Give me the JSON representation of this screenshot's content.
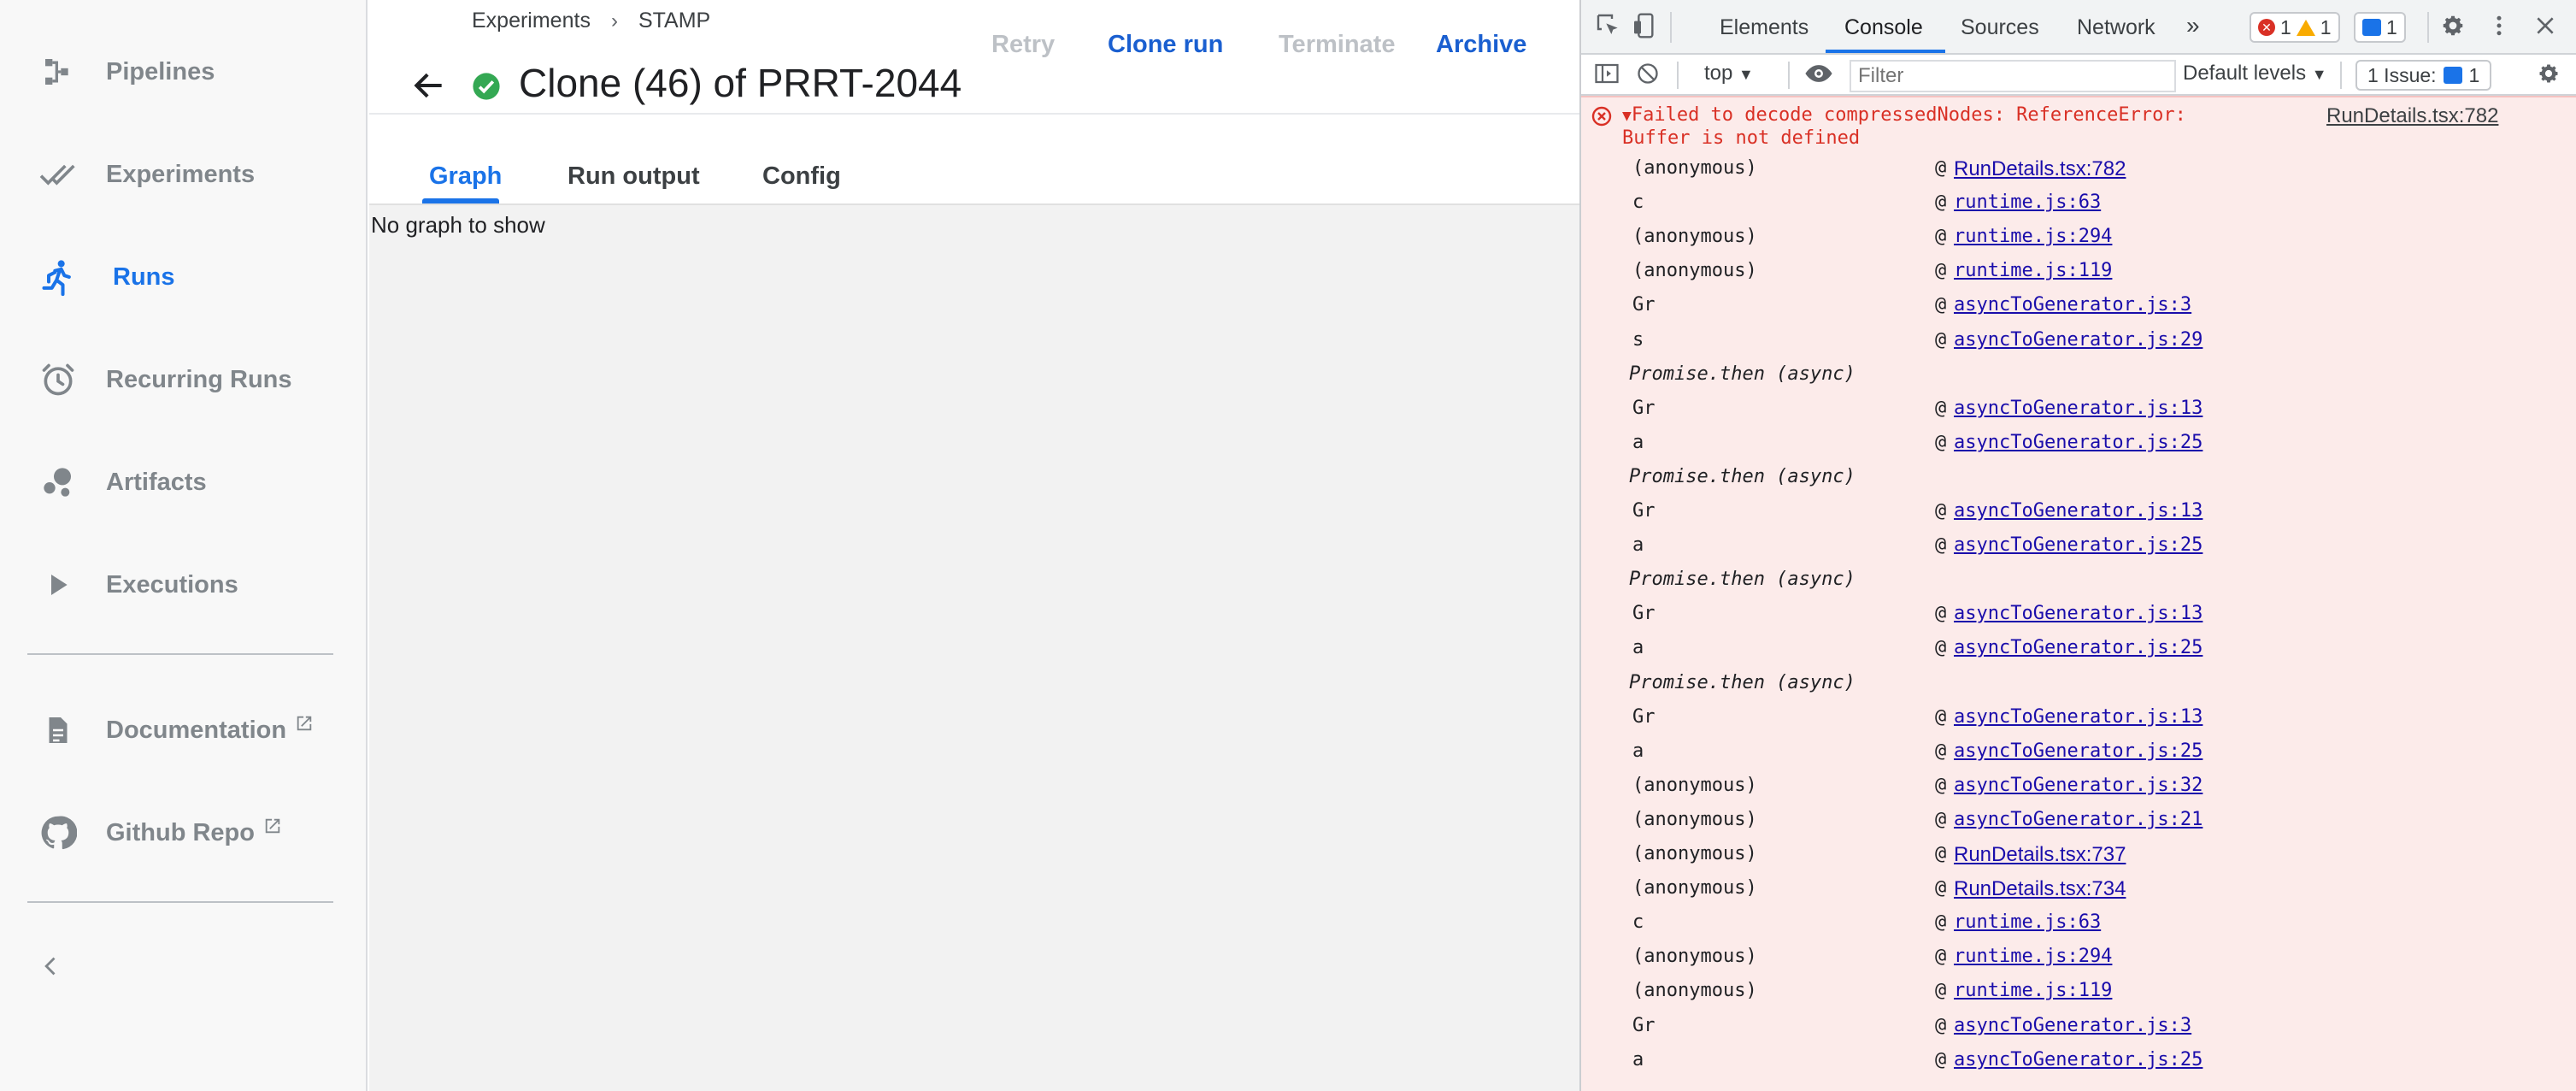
{
  "sidebar": {
    "items": [
      {
        "label": "Pipelines",
        "icon": "pipelines-icon",
        "active": false
      },
      {
        "label": "Experiments",
        "icon": "experiments-icon",
        "active": false
      },
      {
        "label": "Runs",
        "icon": "runs-icon",
        "active": true
      },
      {
        "label": "Recurring Runs",
        "icon": "alarm-clock-icon",
        "active": false
      },
      {
        "label": "Artifacts",
        "icon": "artifacts-icon",
        "active": false
      },
      {
        "label": "Executions",
        "icon": "play-icon",
        "active": false
      }
    ],
    "links": [
      {
        "label": "Documentation",
        "icon": "document-icon"
      },
      {
        "label": "Github Repo",
        "icon": "github-icon"
      }
    ],
    "collapse_icon": "chevron-left-icon"
  },
  "main": {
    "breadcrumb": [
      "Experiments",
      "STAMP"
    ],
    "breadcrumb_separator": "›",
    "title": "Clone (46) of PRRT-2044",
    "status": "succeeded",
    "actions": {
      "retry": "Retry",
      "clone_run": "Clone run",
      "terminate": "Terminate",
      "archive": "Archive"
    },
    "tabs": [
      "Graph",
      "Run output",
      "Config"
    ],
    "active_tab": "Graph",
    "empty_message": "No graph to show"
  },
  "devtools": {
    "tabs": [
      "Elements",
      "Console",
      "Sources",
      "Network"
    ],
    "active_tab": "Console",
    "more_tabs": "»",
    "counts": {
      "errors": "1",
      "warnings": "1",
      "messages": "1"
    },
    "context": "top",
    "filter_placeholder": "Filter",
    "levels": "Default levels",
    "issues_label": "1 Issue:",
    "issues_count": "1",
    "error": {
      "message": "Failed to decode compressedNodes: ReferenceError: Buffer is not defined",
      "source": "RunDetails.tsx:782"
    },
    "stack": [
      {
        "fn": "(anonymous)",
        "link": "RunDetails.tsx:782"
      },
      {
        "fn": "c",
        "link": "runtime.js:63"
      },
      {
        "fn": "(anonymous)",
        "link": "runtime.js:294"
      },
      {
        "fn": "(anonymous)",
        "link": "runtime.js:119"
      },
      {
        "fn": "Gr",
        "link": "asyncToGenerator.js:3"
      },
      {
        "fn": "s",
        "link": "asyncToGenerator.js:29"
      },
      {
        "fn": "Promise.then (async)",
        "link": ""
      },
      {
        "fn": "Gr",
        "link": "asyncToGenerator.js:13"
      },
      {
        "fn": "a",
        "link": "asyncToGenerator.js:25"
      },
      {
        "fn": "Promise.then (async)",
        "link": ""
      },
      {
        "fn": "Gr",
        "link": "asyncToGenerator.js:13"
      },
      {
        "fn": "a",
        "link": "asyncToGenerator.js:25"
      },
      {
        "fn": "Promise.then (async)",
        "link": ""
      },
      {
        "fn": "Gr",
        "link": "asyncToGenerator.js:13"
      },
      {
        "fn": "a",
        "link": "asyncToGenerator.js:25"
      },
      {
        "fn": "Promise.then (async)",
        "link": ""
      },
      {
        "fn": "Gr",
        "link": "asyncToGenerator.js:13"
      },
      {
        "fn": "a",
        "link": "asyncToGenerator.js:25"
      },
      {
        "fn": "(anonymous)",
        "link": "asyncToGenerator.js:32"
      },
      {
        "fn": "(anonymous)",
        "link": "asyncToGenerator.js:21"
      },
      {
        "fn": "(anonymous)",
        "link": "RunDetails.tsx:737"
      },
      {
        "fn": "(anonymous)",
        "link": "RunDetails.tsx:734"
      },
      {
        "fn": "c",
        "link": "runtime.js:63"
      },
      {
        "fn": "(anonymous)",
        "link": "runtime.js:294"
      },
      {
        "fn": "(anonymous)",
        "link": "runtime.js:119"
      },
      {
        "fn": "Gr",
        "link": "asyncToGenerator.js:3"
      },
      {
        "fn": "a",
        "link": "asyncToGenerator.js:25"
      }
    ]
  },
  "colors": {
    "accent": "#1a73e8",
    "success": "#34a853",
    "error": "#d93025"
  }
}
